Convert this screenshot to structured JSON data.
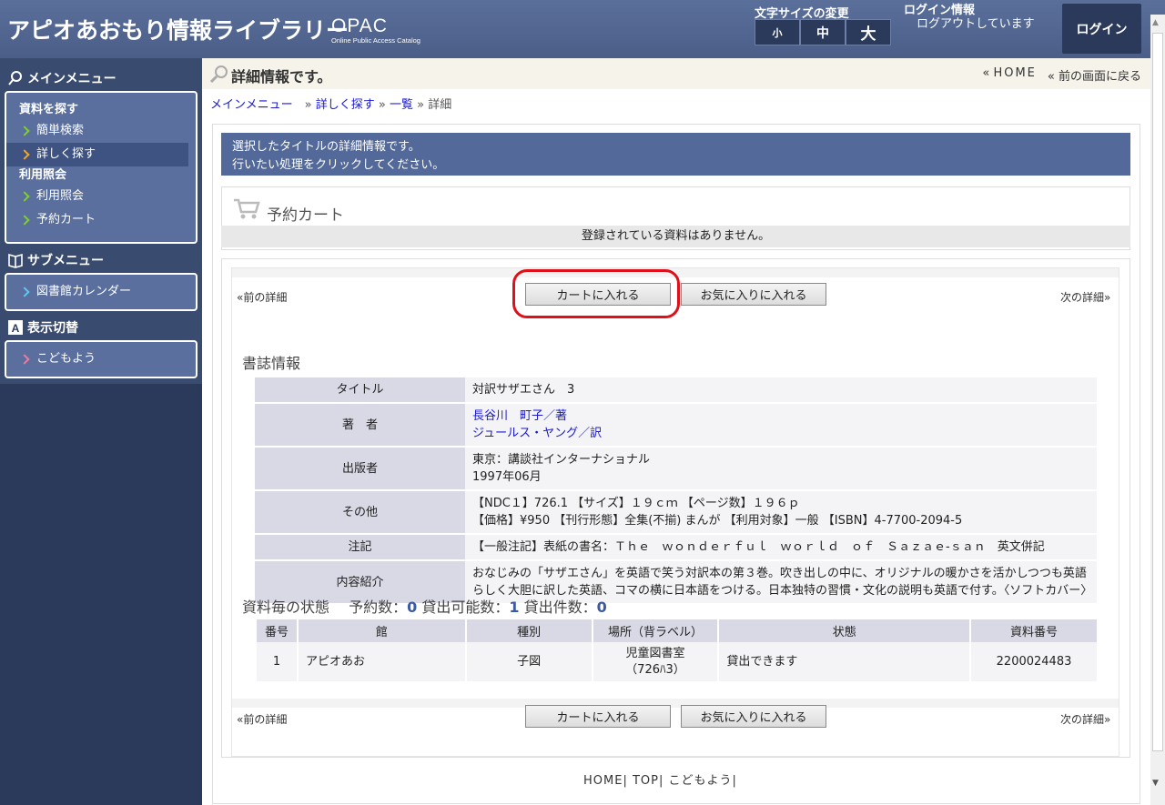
{
  "header": {
    "site_title": "アピオあおもり情報ライブラリー",
    "opac": "OPAC",
    "opac_sub": "Online Public Access Catalog",
    "font_size_label": "文字サイズの変更",
    "font_sizes": [
      "小",
      "中",
      "大"
    ],
    "login_info_title": "ログイン情報",
    "login_status": "ログアウトしています",
    "login_button": "ログイン"
  },
  "sidebar": {
    "main_menu_title": "メインメニュー",
    "search_head": "資料を探す",
    "items_search": [
      "簡単検索",
      "詳しく探す"
    ],
    "usage_head": "利用照会",
    "items_usage": [
      "利用照会",
      "予約カート"
    ],
    "sub_menu_title": "サブメニュー",
    "sub_items": [
      "図書館カレンダー"
    ],
    "display_title": "表示切替",
    "display_items": [
      "こどもよう"
    ]
  },
  "title_bar": {
    "title": "詳細情報です。",
    "home": "HOME",
    "back": "前の画面に戻る"
  },
  "breadcrumb": [
    "メインメニュー",
    "詳しく探す",
    "一覧",
    "詳細"
  ],
  "info": {
    "line1": "選択したタイトルの詳細情報です。",
    "line2": "行いたい処理をクリックしてください。"
  },
  "cart": {
    "title": "予約カート",
    "empty": "登録されている資料はありません。"
  },
  "actions": {
    "prev": "«前の詳細",
    "next": "次の詳細»",
    "add_cart": "カートに入れる",
    "favorite": "お気に入りに入れる"
  },
  "biblio": {
    "heading": "書誌情報",
    "rows": [
      {
        "label": "タイトル",
        "lines": [
          "対訳サザエさん　3"
        ]
      },
      {
        "label": "著　者",
        "links": [
          "長谷川　町子／著",
          "ジュールス・ヤング／訳"
        ]
      },
      {
        "label": "出版者",
        "lines": [
          "東京：講談社インターナショナル",
          "1997年06月"
        ]
      },
      {
        "label": "その他",
        "lines": [
          "【NDC１】726.1 【サイズ】１９ｃｍ 【ページ数】１９６ｐ",
          "【価格】¥950 【刊行形態】全集(不揃) まんが 【利用対象】一般 【ISBN】4-7700-2094-5"
        ]
      },
      {
        "label": "注記",
        "lines": [
          "【一般注記】表紙の書名：Ｔｈｅ　ｗｏｎｄｅｒｆｕｌ　ｗｏｒｌｄ　ｏｆ　Ｓａｚａｅ‐ｓａｎ　英文併記"
        ]
      },
      {
        "label": "内容紹介",
        "lines": [
          "おなじみの「サザエさん」を英語で笑う対訳本の第３巻。吹き出しの中に、オリジナルの暖かさを活かしつつも英語らしく大胆に訳した英語、コマの横に日本語をつける。日本独特の習慣・文化の説明も英語で付す。〈ソフトカバー〉"
        ]
      }
    ]
  },
  "status": {
    "heading": "資料毎の状態",
    "reserve_label": "予約数：",
    "reserve_count": "0",
    "available_label": "貸出可能数：",
    "available_count": "1",
    "loaned_label": "貸出件数：",
    "loaned_count": "0"
  },
  "holdings": {
    "columns": [
      "番号",
      "館",
      "種別",
      "場所（背ラベル）",
      "状態",
      "資料番号"
    ],
    "rows": [
      [
        "1",
        "アピオあお",
        "子図",
        "児童図書室\n（726ﾊ3）",
        "貸出できます",
        "2200024483"
      ]
    ]
  },
  "footer": [
    "HOME",
    "TOP",
    "こどもよう"
  ],
  "colors": {
    "header_bg": "#4f6490",
    "sidebar_bg": "#2b3a5a",
    "menu_box": "#5a6f9e",
    "highlight": "#e0101a"
  }
}
